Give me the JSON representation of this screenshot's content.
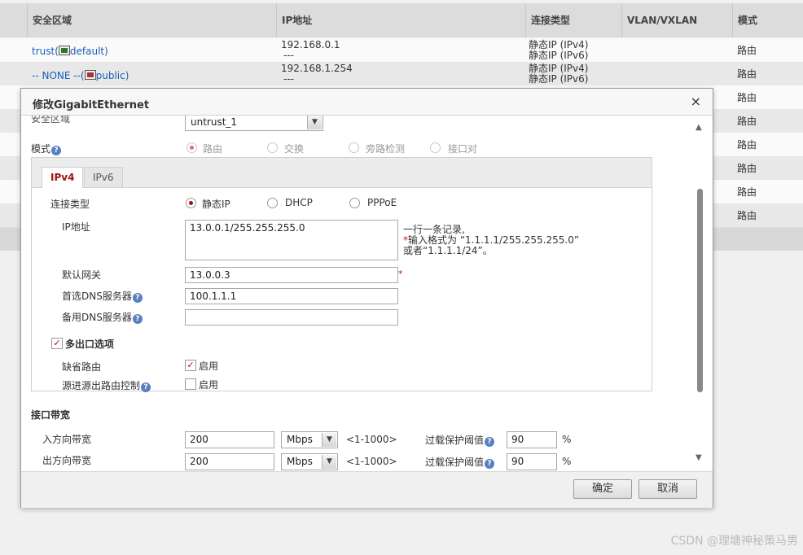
{
  "table": {
    "headers": [
      "安全区域",
      "IP地址",
      "连接类型",
      "VLAN/VXLAN",
      "模式"
    ],
    "rows": [
      {
        "zone_prefix": "trust(",
        "zone_link": "default)",
        "ip": "192.168.0.1",
        "ip2": "---",
        "type1": "静态IP (IPv4)",
        "type2": "静态IP (IPv6)",
        "mode": "路由"
      },
      {
        "zone_prefix": "-- NONE --(",
        "zone_link": "public)",
        "ip": "192.168.1.254",
        "ip2": "---",
        "type1": "静态IP (IPv4)",
        "type2": "静态IP (IPv6)",
        "mode": "路由"
      },
      {
        "mode": "路由"
      },
      {
        "mode": "路由"
      },
      {
        "mode": "路由"
      },
      {
        "mode": "路由"
      },
      {
        "mode": "路由"
      },
      {
        "mode": "路由"
      }
    ]
  },
  "dialog": {
    "title": "修改GigabitEthernet",
    "close_label": "×",
    "zone_label": "安全区域",
    "zone_value": "untrust_1",
    "mode_label": "模式",
    "mode_options": [
      "路由",
      "交换",
      "旁路检测",
      "接口对"
    ],
    "tabs": [
      "IPv4",
      "IPv6"
    ],
    "conn_type_label": "连接类型",
    "conn_options": [
      "静态IP",
      "DHCP",
      "PPPoE"
    ],
    "ip_label": "IP地址",
    "ip_value": "13.0.0.1/255.255.255.0",
    "ip_hint1": "一行一条记录,",
    "ip_hint2": "输入格式为 “1.1.1.1/255.255.255.0”",
    "ip_hint3": "或者“1.1.1.1/24”。",
    "gateway_label": "默认网关",
    "gateway_value": "13.0.0.3",
    "dns1_label": "首选DNS服务器",
    "dns1_value": "100.1.1.1",
    "dns2_label": "备用DNS服务器",
    "dns2_value": "",
    "multi_exit_label": "多出口选项",
    "default_route_label": "缺省路由",
    "default_route_enable": "启用",
    "src_route_label": "源进源出路由控制",
    "src_route_enable": "启用",
    "bandwidth_section": "接口带宽",
    "in_bw_label": "入方向带宽",
    "in_bw_value": "200",
    "out_bw_label": "出方向带宽",
    "out_bw_value": "200",
    "unit": "Mbps",
    "range": "<1-1000>",
    "overload_label": "过载保护阈值",
    "in_threshold": "90",
    "out_threshold": "90",
    "percent": "%",
    "ok_label": "确定",
    "cancel_label": "取消"
  },
  "watermark": "CSDN @理塘神秘策马男"
}
